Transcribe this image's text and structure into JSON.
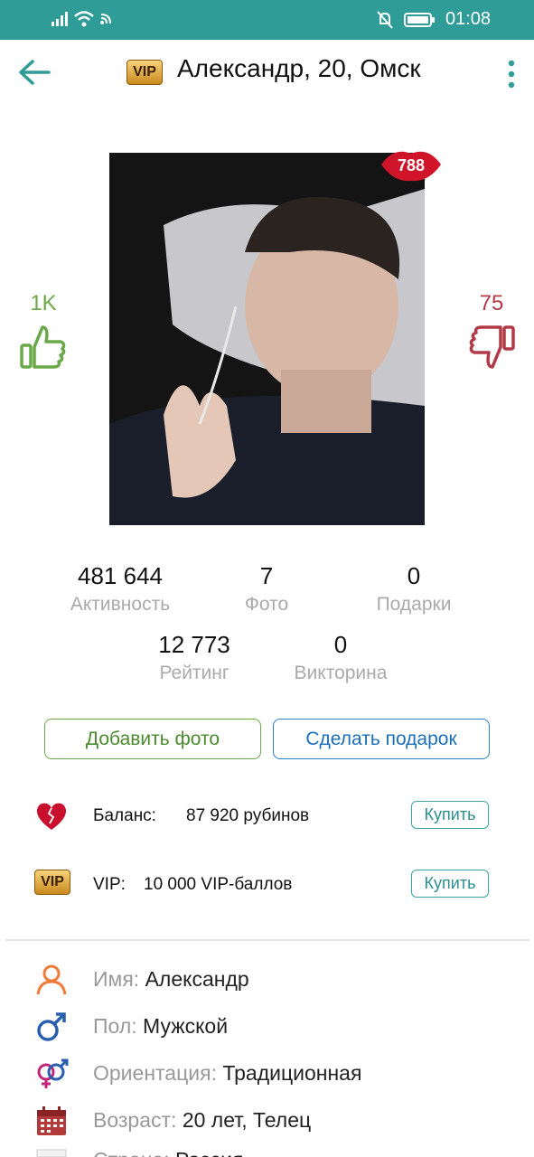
{
  "status_bar": {
    "time": "01:08",
    "icons": [
      "signal-icon",
      "wifi-icon",
      "nfc-icon",
      "mute-icon",
      "battery-icon"
    ],
    "color": "#2f9c98"
  },
  "header": {
    "vip_badge": "VIP",
    "title": "Александр, 20, Омск"
  },
  "photo": {
    "lips_count": "788"
  },
  "votes": {
    "likes": "1K",
    "dislikes": "75",
    "like_color": "#6aa84a",
    "dislike_color": "#b23a48"
  },
  "stats": [
    {
      "value": "481 644",
      "label": "Активность"
    },
    {
      "value": "7",
      "label": "Фото"
    },
    {
      "value": "0",
      "label": "Подарки"
    },
    {
      "value": "12 773",
      "label": "Рейтинг"
    },
    {
      "value": "0",
      "label": "Викторина"
    }
  ],
  "buttons": {
    "add_photo": "Добавить фото",
    "make_gift": "Сделать подарок"
  },
  "balance": {
    "label": "Баланс:",
    "value": "87 920 рубинов",
    "buy": "Купить"
  },
  "vip": {
    "badge": "VIP",
    "label": "VIP:",
    "value": "10 000 VIP-баллов",
    "buy": "Купить"
  },
  "profile": {
    "name": {
      "label": "Имя:",
      "value": "Александр"
    },
    "gender": {
      "label": "Пол:",
      "value": "Мужской"
    },
    "orientation": {
      "label": "Ориентация:",
      "value": "Традиционная"
    },
    "age": {
      "label": "Возраст:",
      "value": "20 лет, Телец"
    },
    "country": {
      "label": "Страна:",
      "value": "Россия"
    }
  }
}
